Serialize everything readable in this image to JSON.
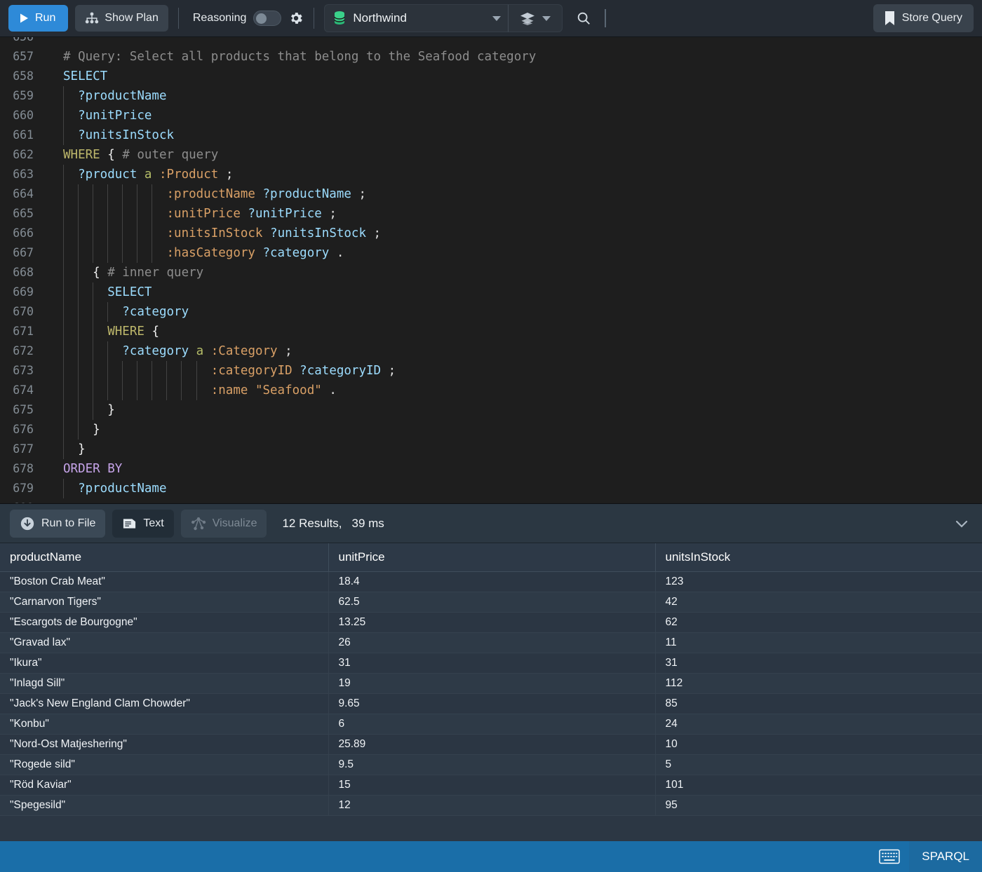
{
  "toolbar": {
    "run_label": "Run",
    "run_icon": "play-icon",
    "show_plan_label": "Show Plan",
    "show_plan_icon": "plan-tree-icon",
    "reasoning_label": "Reasoning",
    "reasoning_toggle_state": "off",
    "settings_icon": "gear-icon",
    "database_icon": "database-icon",
    "database_name": "Northwind",
    "database_caret_icon": "caret-down-icon",
    "layers_icon": "layers-icon",
    "layers_caret_icon": "caret-down-icon",
    "search_icon": "search-icon",
    "store_query_label": "Store Query",
    "store_query_icon": "bookmark-icon",
    "accent_color": "#2e8ad8"
  },
  "editor": {
    "language": "SPARQL",
    "first_visible_line": 656,
    "lines": [
      {
        "num": "656",
        "partial": true,
        "tokens": []
      },
      {
        "num": "657",
        "indent": 0,
        "tokens": [
          {
            "t": "# Query: Select all products that belong to the Seafood category",
            "c": "cmt"
          }
        ]
      },
      {
        "num": "658",
        "indent": 0,
        "tokens": [
          {
            "t": "SELECT",
            "c": "kw-select"
          }
        ]
      },
      {
        "num": "659",
        "indent": 1,
        "tokens": [
          {
            "t": "?productName",
            "c": "var"
          }
        ]
      },
      {
        "num": "660",
        "indent": 1,
        "tokens": [
          {
            "t": "?unitPrice",
            "c": "var"
          }
        ]
      },
      {
        "num": "661",
        "indent": 1,
        "tokens": [
          {
            "t": "?unitsInStock",
            "c": "var"
          }
        ]
      },
      {
        "num": "662",
        "indent": 0,
        "tokens": [
          {
            "t": "WHERE",
            "c": "kw-where"
          },
          {
            "t": " ",
            "c": "punc"
          },
          {
            "t": "{",
            "c": "brace"
          },
          {
            "t": " ",
            "c": "punc"
          },
          {
            "t": "# outer query",
            "c": "cmt"
          }
        ]
      },
      {
        "num": "663",
        "indent": 1,
        "tokens": [
          {
            "t": "?product",
            "c": "var"
          },
          {
            "t": " ",
            "c": "punc"
          },
          {
            "t": "a",
            "c": "kw-a"
          },
          {
            "t": " ",
            "c": "punc"
          },
          {
            "t": ":Product",
            "c": "pred"
          },
          {
            "t": " ",
            "c": "punc"
          },
          {
            "t": ";",
            "c": "punc"
          }
        ]
      },
      {
        "num": "664",
        "indent": 7,
        "tokens": [
          {
            "t": ":productName",
            "c": "pred"
          },
          {
            "t": " ",
            "c": "punc"
          },
          {
            "t": "?productName",
            "c": "var"
          },
          {
            "t": " ",
            "c": "punc"
          },
          {
            "t": ";",
            "c": "punc"
          }
        ]
      },
      {
        "num": "665",
        "indent": 7,
        "tokens": [
          {
            "t": ":unitPrice",
            "c": "pred"
          },
          {
            "t": " ",
            "c": "punc"
          },
          {
            "t": "?unitPrice",
            "c": "var"
          },
          {
            "t": " ",
            "c": "punc"
          },
          {
            "t": ";",
            "c": "punc"
          }
        ]
      },
      {
        "num": "666",
        "indent": 7,
        "tokens": [
          {
            "t": ":unitsInStock",
            "c": "pred"
          },
          {
            "t": " ",
            "c": "punc"
          },
          {
            "t": "?unitsInStock",
            "c": "var"
          },
          {
            "t": " ",
            "c": "punc"
          },
          {
            "t": ";",
            "c": "punc"
          }
        ]
      },
      {
        "num": "667",
        "indent": 7,
        "tokens": [
          {
            "t": ":hasCategory",
            "c": "pred"
          },
          {
            "t": " ",
            "c": "punc"
          },
          {
            "t": "?category",
            "c": "var"
          },
          {
            "t": " ",
            "c": "punc"
          },
          {
            "t": ".",
            "c": "punc"
          }
        ]
      },
      {
        "num": "668",
        "indent": 2,
        "tokens": [
          {
            "t": "{",
            "c": "brace"
          },
          {
            "t": " ",
            "c": "punc"
          },
          {
            "t": "# inner query",
            "c": "cmt"
          }
        ]
      },
      {
        "num": "669",
        "indent": 3,
        "tokens": [
          {
            "t": "SELECT",
            "c": "kw-select"
          }
        ]
      },
      {
        "num": "670",
        "indent": 4,
        "tokens": [
          {
            "t": "?category",
            "c": "var"
          }
        ]
      },
      {
        "num": "671",
        "indent": 3,
        "tokens": [
          {
            "t": "WHERE",
            "c": "kw-where"
          },
          {
            "t": " ",
            "c": "punc"
          },
          {
            "t": "{",
            "c": "brace"
          }
        ]
      },
      {
        "num": "672",
        "indent": 4,
        "tokens": [
          {
            "t": "?category",
            "c": "var"
          },
          {
            "t": " ",
            "c": "punc"
          },
          {
            "t": "a",
            "c": "kw-a"
          },
          {
            "t": " ",
            "c": "punc"
          },
          {
            "t": ":Category",
            "c": "pred"
          },
          {
            "t": " ",
            "c": "punc"
          },
          {
            "t": ";",
            "c": "punc"
          }
        ]
      },
      {
        "num": "673",
        "indent": 10,
        "tokens": [
          {
            "t": ":categoryID",
            "c": "pred"
          },
          {
            "t": " ",
            "c": "punc"
          },
          {
            "t": "?categoryID",
            "c": "var"
          },
          {
            "t": " ",
            "c": "punc"
          },
          {
            "t": ";",
            "c": "punc"
          }
        ]
      },
      {
        "num": "674",
        "indent": 10,
        "tokens": [
          {
            "t": ":name",
            "c": "pred"
          },
          {
            "t": " ",
            "c": "punc"
          },
          {
            "t": "\"Seafood\"",
            "c": "str"
          },
          {
            "t": " ",
            "c": "punc"
          },
          {
            "t": ".",
            "c": "punc"
          }
        ]
      },
      {
        "num": "675",
        "indent": 3,
        "tokens": [
          {
            "t": "}",
            "c": "brace"
          }
        ]
      },
      {
        "num": "676",
        "indent": 2,
        "tokens": [
          {
            "t": "}",
            "c": "brace"
          }
        ]
      },
      {
        "num": "677",
        "indent": 1,
        "tokens": [
          {
            "t": "}",
            "c": "brace"
          }
        ]
      },
      {
        "num": "678",
        "indent": 0,
        "tokens": [
          {
            "t": "ORDER BY",
            "c": "kw-order"
          }
        ]
      },
      {
        "num": "679",
        "indent": 1,
        "tokens": [
          {
            "t": "?productName",
            "c": "var"
          }
        ]
      },
      {
        "num": "680",
        "indent": 0,
        "tokens": []
      }
    ]
  },
  "results_bar": {
    "run_to_file_label": "Run to File",
    "run_to_file_icon": "download-circle-icon",
    "text_label": "Text",
    "text_icon": "document-icon",
    "visualize_label": "Visualize",
    "visualize_icon": "graph-nodes-icon",
    "visualize_disabled": true,
    "result_count_label": "12 Results,",
    "duration_label": "39 ms",
    "collapse_icon": "chevron-down-icon"
  },
  "results_table": {
    "columns": [
      "productName",
      "unitPrice",
      "unitsInStock"
    ],
    "rows": [
      [
        "\"Boston Crab Meat\"",
        "18.4",
        "123"
      ],
      [
        "\"Carnarvon Tigers\"",
        "62.5",
        "42"
      ],
      [
        "\"Escargots de Bourgogne\"",
        "13.25",
        "62"
      ],
      [
        "\"Gravad lax\"",
        "26",
        "11"
      ],
      [
        "\"Ikura\"",
        "31",
        "31"
      ],
      [
        "\"Inlagd Sill\"",
        "19",
        "112"
      ],
      [
        "\"Jack's New England Clam Chowder\"",
        "9.65",
        "85"
      ],
      [
        "\"Konbu\"",
        "6",
        "24"
      ],
      [
        "\"Nord-Ost Matjeshering\"",
        "25.89",
        "10"
      ],
      [
        "\"Rogede sild\"",
        "9.5",
        "5"
      ],
      [
        "\"Röd Kaviar\"",
        "15",
        "101"
      ],
      [
        "\"Spegesild\"",
        "12",
        "95"
      ]
    ]
  },
  "statusbar": {
    "keyboard_icon": "keyboard-icon",
    "language_label": "SPARQL",
    "background_color": "#1a6ea8"
  }
}
